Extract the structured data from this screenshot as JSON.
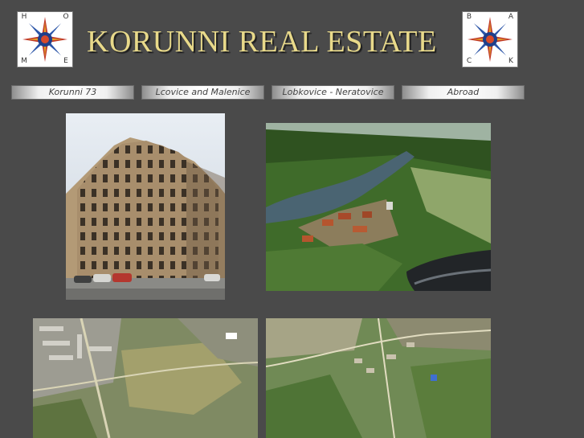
{
  "site_title": "KORUNNI REAL ESTATE",
  "home_logo": {
    "letters_top": [
      "H",
      "O"
    ],
    "letters_bottom": [
      "M",
      "E"
    ]
  },
  "back_logo": {
    "letters_top": [
      "B",
      "A"
    ],
    "letters_bottom": [
      "C",
      "K"
    ]
  },
  "nav": [
    {
      "label": "Korunni 73"
    },
    {
      "label": "Lcovice and Malenice"
    },
    {
      "label": "Lobkovice - Neratovice"
    },
    {
      "label": "Abroad"
    }
  ],
  "photos": [
    {
      "subject": "apartment-building-photo"
    },
    {
      "subject": "aerial-river-village-photo"
    },
    {
      "subject": "aerial-map-housing-estate"
    },
    {
      "subject": "aerial-map-village"
    }
  ],
  "colors": {
    "background": "#4a4a4a",
    "title": "#e8d98a"
  }
}
